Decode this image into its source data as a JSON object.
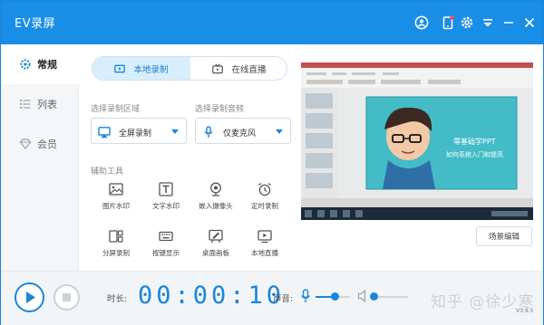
{
  "window": {
    "title": "EV录屏"
  },
  "sidebar": {
    "items": [
      {
        "label": "常规",
        "icon": "gear-icon",
        "active": true
      },
      {
        "label": "列表",
        "icon": "list-icon",
        "active": false
      },
      {
        "label": "会员",
        "icon": "diamond-icon",
        "active": false
      }
    ]
  },
  "mode_tabs": [
    {
      "label": "本地录制",
      "icon": "video-icon",
      "active": true
    },
    {
      "label": "在线直播",
      "icon": "tv-icon",
      "active": false
    }
  ],
  "record_area": {
    "label": "选择录制区域",
    "value": "全屏录制",
    "icon": "monitor-icon"
  },
  "record_audio": {
    "label": "选择录制音频",
    "value": "仅麦克风",
    "icon": "microphone-icon"
  },
  "tools": {
    "label": "辅助工具",
    "items": [
      {
        "label": "图片水印",
        "icon": "image-icon"
      },
      {
        "label": "文字水印",
        "icon": "text-icon"
      },
      {
        "label": "嵌入摄像头",
        "icon": "webcam-icon"
      },
      {
        "label": "定时录制",
        "icon": "alarm-clock-icon"
      },
      {
        "label": "分屏录制",
        "icon": "split-screen-icon"
      },
      {
        "label": "按键显示",
        "icon": "keyboard-icon"
      },
      {
        "label": "桌面画板",
        "icon": "drawing-board-icon"
      },
      {
        "label": "本地直播",
        "icon": "local-live-icon"
      }
    ]
  },
  "preview": {
    "slide_text_line1": "零基础学PPT",
    "slide_text_line2": "如何系统入门和提高"
  },
  "scene_button": {
    "label": "场景编辑"
  },
  "bottom": {
    "duration_label": "时长:",
    "timer": "00:00:10",
    "volume_label": "声音:",
    "mic_volume": 0.55,
    "speaker_volume": 0.05,
    "watermark": "知乎 @徐少寒",
    "version": "V3.9.5"
  },
  "colors": {
    "accent": "#1a8ee6",
    "timer": "#1a86d9",
    "sidebar_bg": "#f4f6f8",
    "active_tab_bg": "#d9eefc"
  }
}
